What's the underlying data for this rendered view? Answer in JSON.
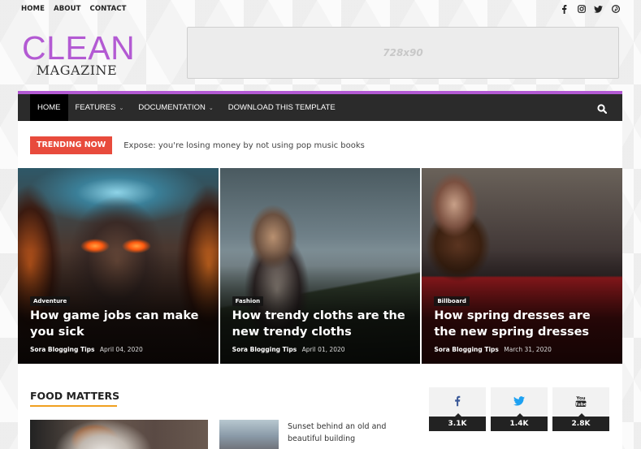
{
  "topbar": {
    "links": [
      "HOME",
      "ABOUT",
      "CONTACT"
    ],
    "social_icons": [
      "facebook-icon",
      "instagram-icon",
      "twitter-icon",
      "pinterest-icon"
    ]
  },
  "logo": {
    "line1": "CLEAN",
    "line2": "MAGAZINE",
    "accent_color": "#b35ad3"
  },
  "ad": {
    "label": "728x90"
  },
  "nav": {
    "items": [
      {
        "label": "HOME",
        "active": true,
        "dropdown": false
      },
      {
        "label": "FEATURES",
        "active": false,
        "dropdown": true
      },
      {
        "label": "DOCUMENTATION",
        "active": false,
        "dropdown": true
      },
      {
        "label": "DOWNLOAD THIS TEMPLATE",
        "active": false,
        "dropdown": false
      }
    ],
    "search_icon": "search-icon"
  },
  "trending": {
    "label": "TRENDING NOW",
    "text": "Expose: you're losing money by not using pop music books",
    "color": "#e84b3c"
  },
  "featured": [
    {
      "category": "Adventure",
      "title": "How game jobs can make you sick",
      "author": "Sora Blogging Tips",
      "date": "April 04, 2020"
    },
    {
      "category": "Fashion",
      "title": "How trendy cloths are the new trendy cloths",
      "author": "Sora Blogging Tips",
      "date": "April 01, 2020"
    },
    {
      "category": "Billboard",
      "title": "How spring dresses are the new spring dresses",
      "author": "Sora Blogging Tips",
      "date": "March 31, 2020"
    }
  ],
  "food_section": {
    "title": "FOOD MATTERS",
    "underline_color": "#f0a020",
    "side_post_title": "Sunset behind an old and beautiful building"
  },
  "social_counters": [
    {
      "network": "facebook",
      "count": "3.1K",
      "color": "#3b5998"
    },
    {
      "network": "twitter",
      "count": "1.4K",
      "color": "#1da1f2"
    },
    {
      "network": "youtube",
      "count": "2.8K",
      "color": "#222222"
    }
  ]
}
